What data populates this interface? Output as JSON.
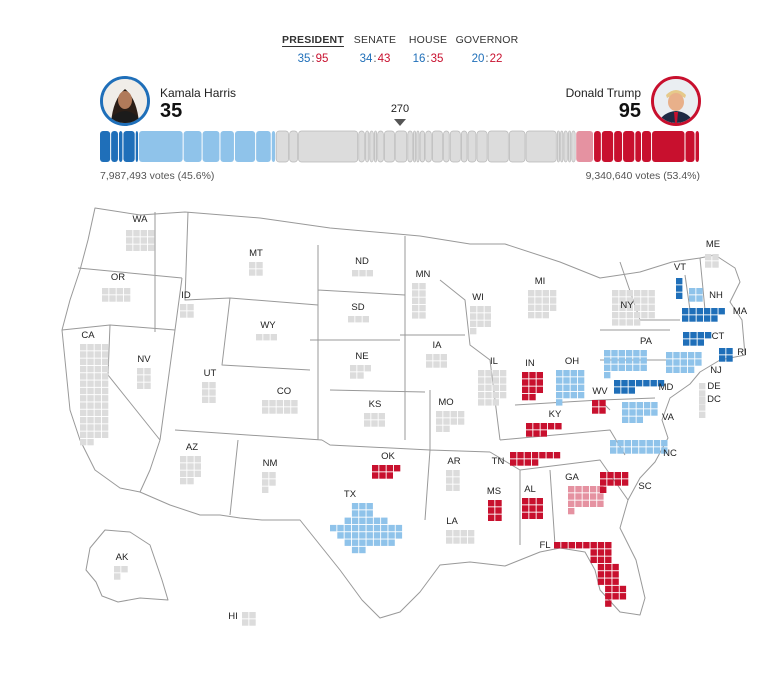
{
  "tabs": [
    {
      "label": "PRESIDENT",
      "dem": "35",
      "rep": "95",
      "active": true
    },
    {
      "label": "SENATE",
      "dem": "34",
      "rep": "43",
      "active": false
    },
    {
      "label": "HOUSE",
      "dem": "16",
      "rep": "35",
      "active": false
    },
    {
      "label": "GOVERNOR",
      "dem": "20",
      "rep": "22",
      "active": false
    }
  ],
  "candidates": {
    "dem": {
      "name": "Kamala Harris",
      "electoral_votes": "35",
      "votes": "7,987,493 votes (45.6%)"
    },
    "rep": {
      "name": "Donald Trump",
      "electoral_votes": "95",
      "votes": "9,340,640 votes (53.4%)"
    }
  },
  "threshold": "270",
  "colors": {
    "dem_called": "#1f6fb9",
    "dem_leaning": "#8fc3ea",
    "rep_called": "#c8102e",
    "rep_leaning": "#e592a1",
    "uncalled": "#dcdcdc",
    "border": "#999999"
  },
  "states": [
    {
      "abbr": "WA",
      "ev": 12,
      "status": "none"
    },
    {
      "abbr": "OR",
      "ev": 8,
      "status": "none"
    },
    {
      "abbr": "CA",
      "ev": 54,
      "status": "none"
    },
    {
      "abbr": "NV",
      "ev": 6,
      "status": "none"
    },
    {
      "abbr": "ID",
      "ev": 4,
      "status": "none"
    },
    {
      "abbr": "MT",
      "ev": 4,
      "status": "none"
    },
    {
      "abbr": "WY",
      "ev": 3,
      "status": "none"
    },
    {
      "abbr": "UT",
      "ev": 6,
      "status": "none"
    },
    {
      "abbr": "CO",
      "ev": 10,
      "status": "none"
    },
    {
      "abbr": "AZ",
      "ev": 11,
      "status": "none"
    },
    {
      "abbr": "NM",
      "ev": 5,
      "status": "none"
    },
    {
      "abbr": "ND",
      "ev": 3,
      "status": "none"
    },
    {
      "abbr": "SD",
      "ev": 3,
      "status": "none"
    },
    {
      "abbr": "NE",
      "ev": 5,
      "status": "none"
    },
    {
      "abbr": "KS",
      "ev": 6,
      "status": "none"
    },
    {
      "abbr": "OK",
      "ev": 7,
      "status": "rep"
    },
    {
      "abbr": "TX",
      "ev": 40,
      "status": "dem-lean"
    },
    {
      "abbr": "MN",
      "ev": 10,
      "status": "none"
    },
    {
      "abbr": "IA",
      "ev": 6,
      "status": "none"
    },
    {
      "abbr": "MO",
      "ev": 10,
      "status": "none"
    },
    {
      "abbr": "AR",
      "ev": 6,
      "status": "none"
    },
    {
      "abbr": "LA",
      "ev": 8,
      "status": "none"
    },
    {
      "abbr": "WI",
      "ev": 10,
      "status": "none"
    },
    {
      "abbr": "IL",
      "ev": 19,
      "status": "none"
    },
    {
      "abbr": "MI",
      "ev": 15,
      "status": "none"
    },
    {
      "abbr": "IN",
      "ev": 11,
      "status": "rep"
    },
    {
      "abbr": "OH",
      "ev": 17,
      "status": "dem-lean"
    },
    {
      "abbr": "KY",
      "ev": 8,
      "status": "rep"
    },
    {
      "abbr": "TN",
      "ev": 11,
      "status": "rep"
    },
    {
      "abbr": "MS",
      "ev": 6,
      "status": "rep"
    },
    {
      "abbr": "AL",
      "ev": 9,
      "status": "rep"
    },
    {
      "abbr": "GA",
      "ev": 16,
      "status": "rep-lean"
    },
    {
      "abbr": "FL",
      "ev": 30,
      "status": "rep"
    },
    {
      "abbr": "SC",
      "ev": 9,
      "status": "rep"
    },
    {
      "abbr": "NC",
      "ev": 16,
      "status": "dem-lean"
    },
    {
      "abbr": "VA",
      "ev": 13,
      "status": "dem-lean"
    },
    {
      "abbr": "WV",
      "ev": 4,
      "status": "rep"
    },
    {
      "abbr": "PA",
      "ev": 19,
      "status": "dem-lean"
    },
    {
      "abbr": "NY",
      "ev": 28,
      "status": "none"
    },
    {
      "abbr": "MD",
      "ev": 10,
      "status": "dem"
    },
    {
      "abbr": "DE",
      "ev": 3,
      "status": "none"
    },
    {
      "abbr": "DC",
      "ev": 3,
      "status": "none"
    },
    {
      "abbr": "NJ",
      "ev": 14,
      "status": "dem-lean"
    },
    {
      "abbr": "CT",
      "ev": 7,
      "status": "dem"
    },
    {
      "abbr": "RI",
      "ev": 4,
      "status": "dem"
    },
    {
      "abbr": "MA",
      "ev": 11,
      "status": "dem"
    },
    {
      "abbr": "VT",
      "ev": 3,
      "status": "dem"
    },
    {
      "abbr": "NH",
      "ev": 4,
      "status": "dem-lean"
    },
    {
      "abbr": "ME",
      "ev": 4,
      "status": "none"
    },
    {
      "abbr": "AK",
      "ev": 3,
      "status": "none"
    },
    {
      "abbr": "HI",
      "ev": 4,
      "status": "none"
    }
  ]
}
